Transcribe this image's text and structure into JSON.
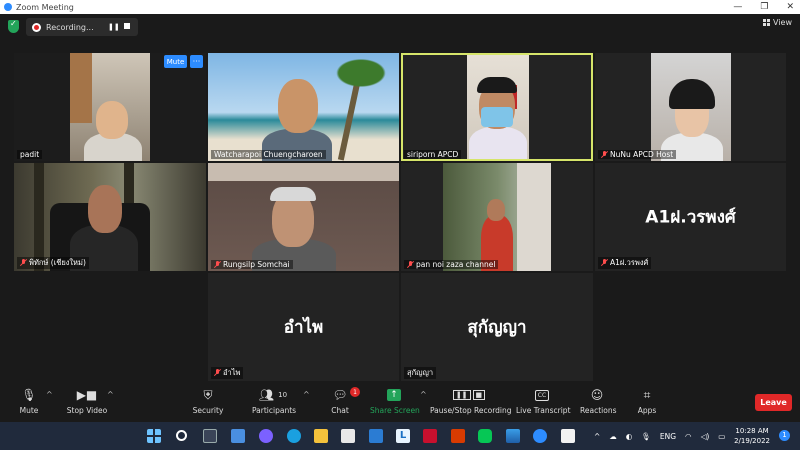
{
  "window": {
    "title": "Zoom Meeting",
    "controls": [
      "—",
      "❐",
      "✕"
    ]
  },
  "topbar": {
    "recording_label": "Recording...",
    "view_label": "View"
  },
  "tiles": [
    {
      "id": "padit",
      "name": "padit",
      "muted": false,
      "video": true
    },
    {
      "id": "watcharapoi",
      "name": "Watcharapoi Chuengcharoen",
      "muted": false,
      "video": true
    },
    {
      "id": "siriporn",
      "name": "siriporn APCD",
      "muted": false,
      "video": true,
      "active_speaker": true
    },
    {
      "id": "nunu",
      "name": "NuNu APCD Host",
      "muted": true,
      "video": true
    },
    {
      "id": "tile5",
      "name": "พิทักษ์ (เชียงใหม่)",
      "muted": true,
      "video": true
    },
    {
      "id": "rungsilp",
      "name": "Rungsilp Somchai",
      "muted": true,
      "video": true
    },
    {
      "id": "pannoi",
      "name": "pan noi zaza channel",
      "muted": true,
      "video": true
    },
    {
      "id": "a1",
      "name": "A1ฝ.วรพงศ์",
      "display_name": "A1ฝ.วรพงศ์",
      "muted": true,
      "video": false
    },
    {
      "id": "amphai",
      "name": "อำไพ",
      "display_name": "อำไพ",
      "muted": true,
      "video": false
    },
    {
      "id": "sukanya",
      "name": "สุกัญญา",
      "display_name": "สุกัญญา",
      "muted": false,
      "video": false
    }
  ],
  "tile_controls": {
    "mute_label": "Mute",
    "more_label": "···"
  },
  "toolbar": {
    "mute": "Mute",
    "stop_video": "Stop Video",
    "security": "Security",
    "participants": "Participants",
    "participants_count": "10",
    "chat": "Chat",
    "chat_badge": "1",
    "share_screen": "Share Screen",
    "pause_stop_recording": "Pause/Stop Recording",
    "live_transcript": "Live Transcript",
    "live_transcript_icon": "CC",
    "reactions": "Reactions",
    "apps": "Apps",
    "leave": "Leave"
  },
  "taskbar": {
    "language": "ENG",
    "time": "10:28 AM",
    "date": "2/19/2022",
    "notification_count": "1"
  },
  "colors": {
    "accent": "#2d8cff",
    "active_speaker": "#d6e56a",
    "leave": "#e02828",
    "share": "#23a45a"
  }
}
